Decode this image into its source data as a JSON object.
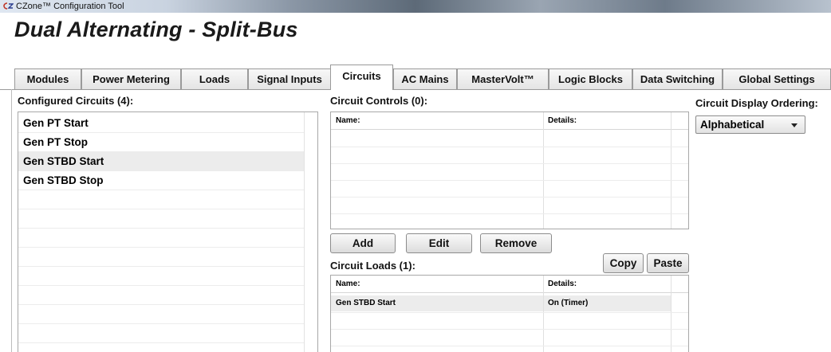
{
  "window": {
    "title": "CZone™ Configuration Tool"
  },
  "heading": "Dual Alternating - Split-Bus",
  "tabs": [
    {
      "label": "Modules"
    },
    {
      "label": "Power Metering"
    },
    {
      "label": "Loads"
    },
    {
      "label": "Signal Inputs"
    },
    {
      "label": "Circuits",
      "active": true
    },
    {
      "label": "AC Mains"
    },
    {
      "label": "MasterVolt™"
    },
    {
      "label": "Logic Blocks"
    },
    {
      "label": "Data Switching"
    },
    {
      "label": "Global Settings"
    }
  ],
  "configured": {
    "label": "Configured Circuits (4):",
    "items": [
      "Gen PT Start",
      "Gen PT Stop",
      "Gen STBD Start",
      "Gen STBD Stop"
    ],
    "selected": "Gen STBD Start"
  },
  "controls": {
    "label": "Circuit Controls (0):",
    "columns": {
      "name": "Name:",
      "details": "Details:"
    },
    "rows": []
  },
  "buttons": {
    "add": "Add",
    "edit": "Edit",
    "remove": "Remove",
    "copy": "Copy",
    "paste": "Paste"
  },
  "loads": {
    "label": "Circuit Loads (1):",
    "columns": {
      "name": "Name:",
      "details": "Details:"
    },
    "rows": [
      {
        "name": "Gen STBD Start",
        "details": "On (Timer)"
      }
    ]
  },
  "ordering": {
    "label": "Circuit Display Ordering:",
    "value": "Alphabetical"
  },
  "icons": {
    "app": "czone-logo-icon",
    "dropdown": "chevron-down-icon"
  }
}
